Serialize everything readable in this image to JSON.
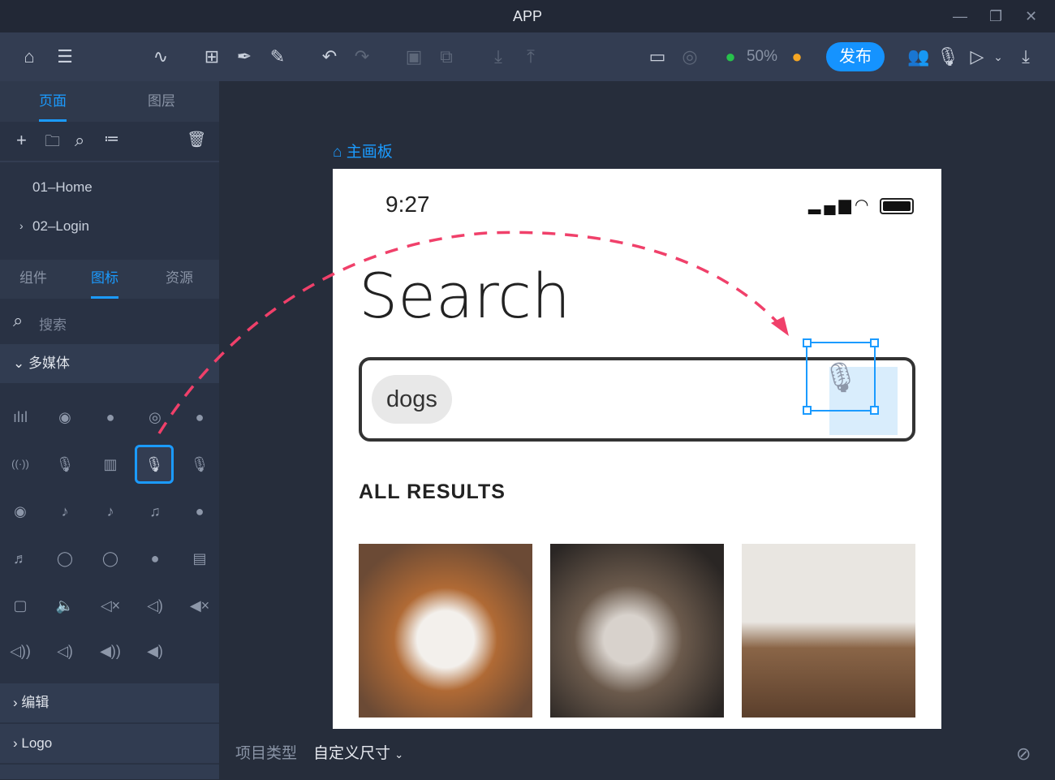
{
  "window": {
    "title": "APP"
  },
  "toolbar": {
    "zoom": "50%",
    "publish": "发布"
  },
  "sidebar": {
    "top_tabs": [
      {
        "label": "页面",
        "active": true
      },
      {
        "label": "图层",
        "active": false
      }
    ],
    "pages": [
      {
        "label": "01–Home"
      },
      {
        "label": "02–Login"
      }
    ],
    "lib_tabs": [
      {
        "label": "组件"
      },
      {
        "label": "图标",
        "active": true
      },
      {
        "label": "资源"
      }
    ],
    "search_placeholder": "搜索",
    "sections": [
      {
        "label": "多媒体",
        "expanded": true
      },
      {
        "label": "编辑"
      },
      {
        "label": "Logo"
      }
    ]
  },
  "canvas": {
    "board_label": "主画板"
  },
  "phone": {
    "time": "9:27",
    "title": "Search",
    "chip": "dogs",
    "results_heading": "ALL RESULTS"
  },
  "bottom": {
    "label": "项目类型",
    "value": "自定义尺寸"
  },
  "colors": {
    "accent": "#1b9bff",
    "arrow": "#f0406a"
  }
}
